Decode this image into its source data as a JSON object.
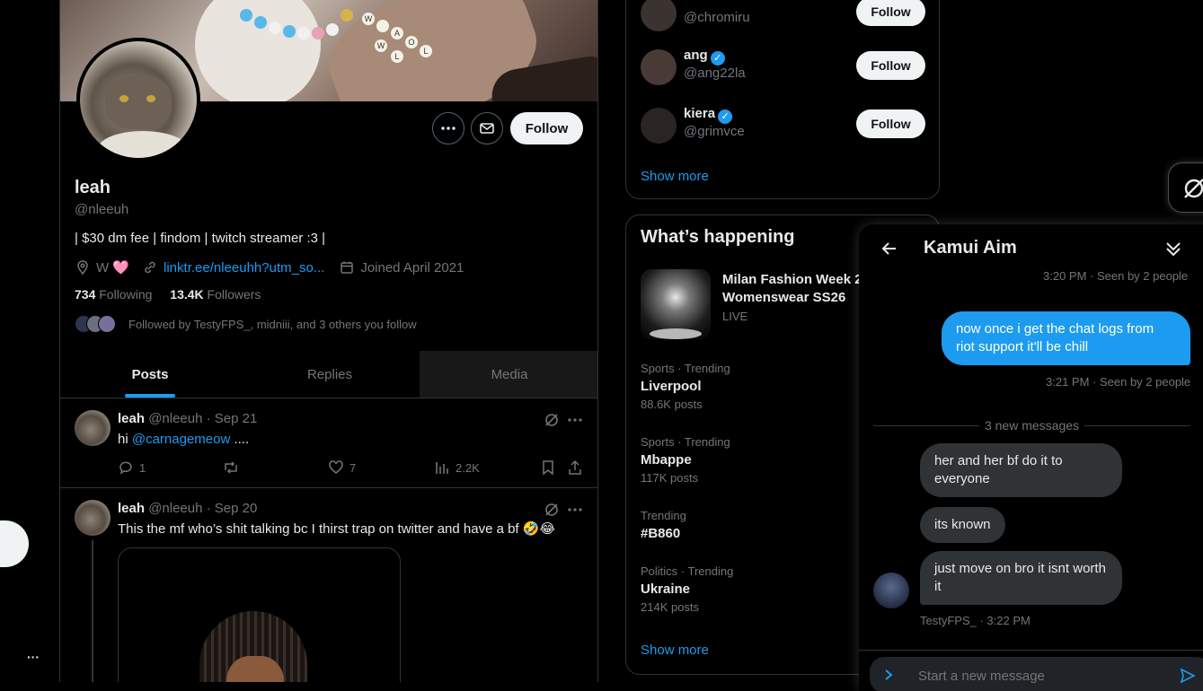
{
  "profile": {
    "name": "leah",
    "handle": "@nleeuh",
    "bio": "| $30 dm fee | findom | twitch streamer :3 |",
    "location": "W 🩷",
    "link": "linktr.ee/nleeuhh?utm_so...",
    "joined": "Joined April 2021",
    "following_count": "734",
    "following_label": "Following",
    "followers_count": "13.4K",
    "followers_label": "Followers",
    "followed_by": "Followed by TestyFPS_, midniii, and 3 others you follow",
    "follow_button": "Follow",
    "banner_beads": "W A O L W L"
  },
  "tabs": [
    "Posts",
    "Replies",
    "Media"
  ],
  "posts": [
    {
      "name": "leah",
      "handle": "@nleeuh",
      "date": "· Sep 21",
      "text_prefix": "hi ",
      "mention": "@carnagemeow",
      "text_suffix": " ....",
      "replies": "1",
      "reposts": "",
      "likes": "7",
      "views": "2.2K"
    },
    {
      "name": "leah",
      "handle": "@nleeuh",
      "date": "· Sep 20",
      "text": "This the mf who’s shit talking bc I thirst trap on twitter and have a bf 🤣😂"
    }
  ],
  "who_to_follow": [
    {
      "name": "",
      "handle": "@chromiru",
      "verified": false,
      "button": "Follow",
      "color": "#3a3330"
    },
    {
      "name": "ang",
      "handle": "@ang22la",
      "verified": true,
      "button": "Follow",
      "color": "#4a3a36"
    },
    {
      "name": "kiera",
      "handle": "@grimvce",
      "verified": true,
      "button": "Follow",
      "color": "#2a2522"
    }
  ],
  "who_show_more": "Show more",
  "happening": {
    "title": "What’s happening",
    "event_title": "Milan Fashion Week 2",
    "event_subtitle": "Womenswear SS26",
    "event_status": "LIVE",
    "trends": [
      {
        "category": "Sports · Trending",
        "name": "Liverpool",
        "count": "88.6K posts"
      },
      {
        "category": "Sports · Trending",
        "name": "Mbappe",
        "count": "117K posts"
      },
      {
        "category": "Trending",
        "name": "#B860",
        "count": ""
      },
      {
        "category": "Politics · Trending",
        "name": "Ukraine",
        "count": "214K posts"
      }
    ],
    "show_more": "Show more"
  },
  "chat": {
    "title": "Kamui Aim",
    "seen1": "3:20 PM · Seen by 2 people",
    "outgoing": "now once i get the chat logs from riot support it'll be chill",
    "seen2": "3:21 PM · Seen by 2 people",
    "new_messages": "3 new messages",
    "incoming": [
      "her and her bf do it to everyone",
      "its known",
      "just move on bro it isnt worth it"
    ],
    "sender_time": "TestyFPS_ · 3:22 PM",
    "input_placeholder": "Start a new message"
  },
  "nav": {
    "more": "···"
  },
  "colors": {
    "accent": "#1d9bf0",
    "background": "#000000",
    "border": "#2f3336",
    "muted": "#71767b"
  }
}
